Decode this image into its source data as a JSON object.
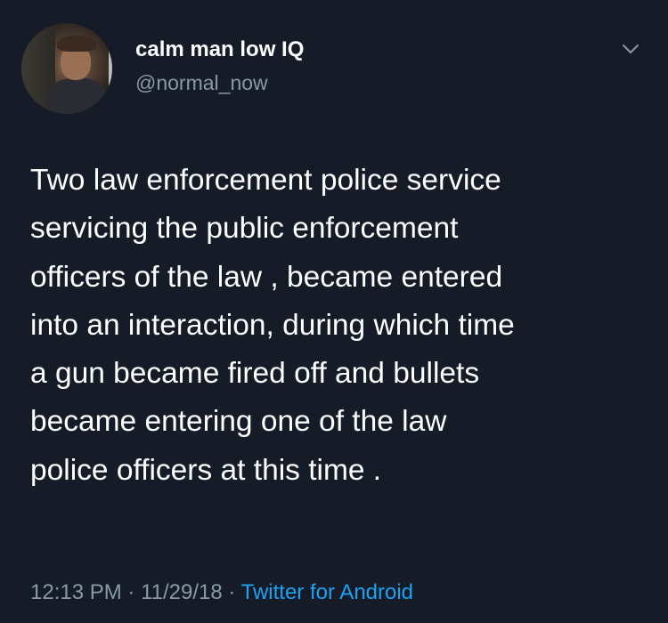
{
  "user": {
    "display_name": "calm man low IQ",
    "handle": "@normal_now"
  },
  "tweet": {
    "lines": [
      "Two law enforcement police service",
      "servicing the public enforcement",
      "officers of the law , became entered",
      "into an interaction, during which time",
      "a gun became fired off and bullets",
      "became entering one of the law",
      "police officers at this time ."
    ],
    "time": "12:13 PM",
    "separator": " · ",
    "date": "11/29/18",
    "source": "Twitter for Android"
  },
  "icons": {
    "menu": "chevron-down-icon",
    "avatar": "avatar-photo"
  },
  "colors": {
    "background": "#151c28",
    "secondary_text": "#8899a6",
    "link": "#1da1f2"
  }
}
